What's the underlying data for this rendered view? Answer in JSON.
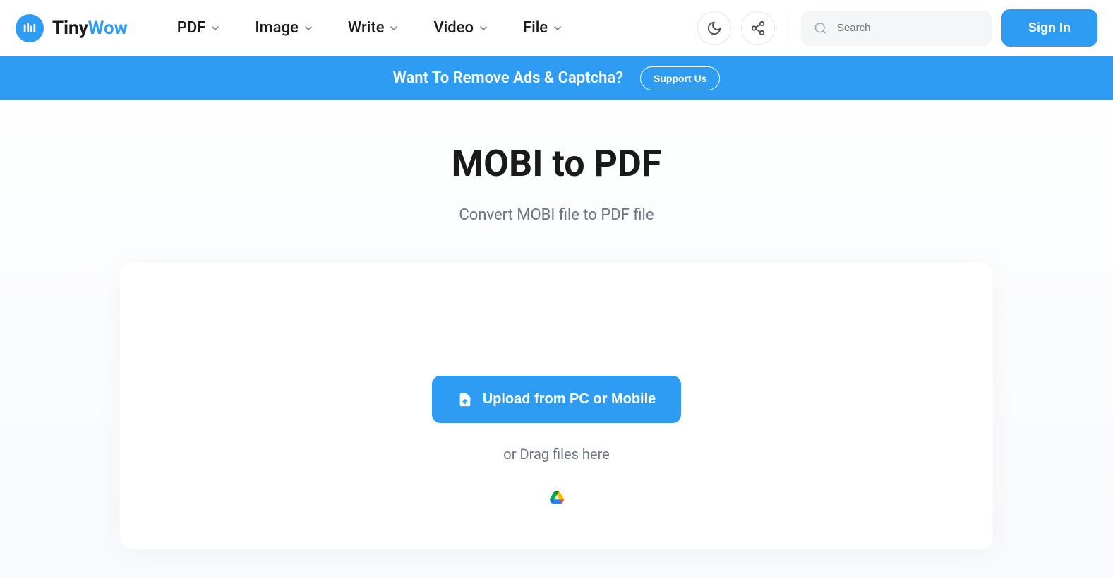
{
  "logo": {
    "part1": "Tiny",
    "part2": "Wow"
  },
  "nav": {
    "items": [
      "PDF",
      "Image",
      "Write",
      "Video",
      "File"
    ]
  },
  "search": {
    "placeholder": "Search"
  },
  "signin": {
    "label": "Sign In"
  },
  "banner": {
    "text": "Want To Remove Ads & Captcha?",
    "button": "Support Us"
  },
  "page": {
    "title": "MOBI to PDF",
    "subtitle": "Convert MOBI file to PDF file"
  },
  "upload": {
    "button": "Upload from PC or Mobile",
    "drag_text": "or Drag files here"
  }
}
